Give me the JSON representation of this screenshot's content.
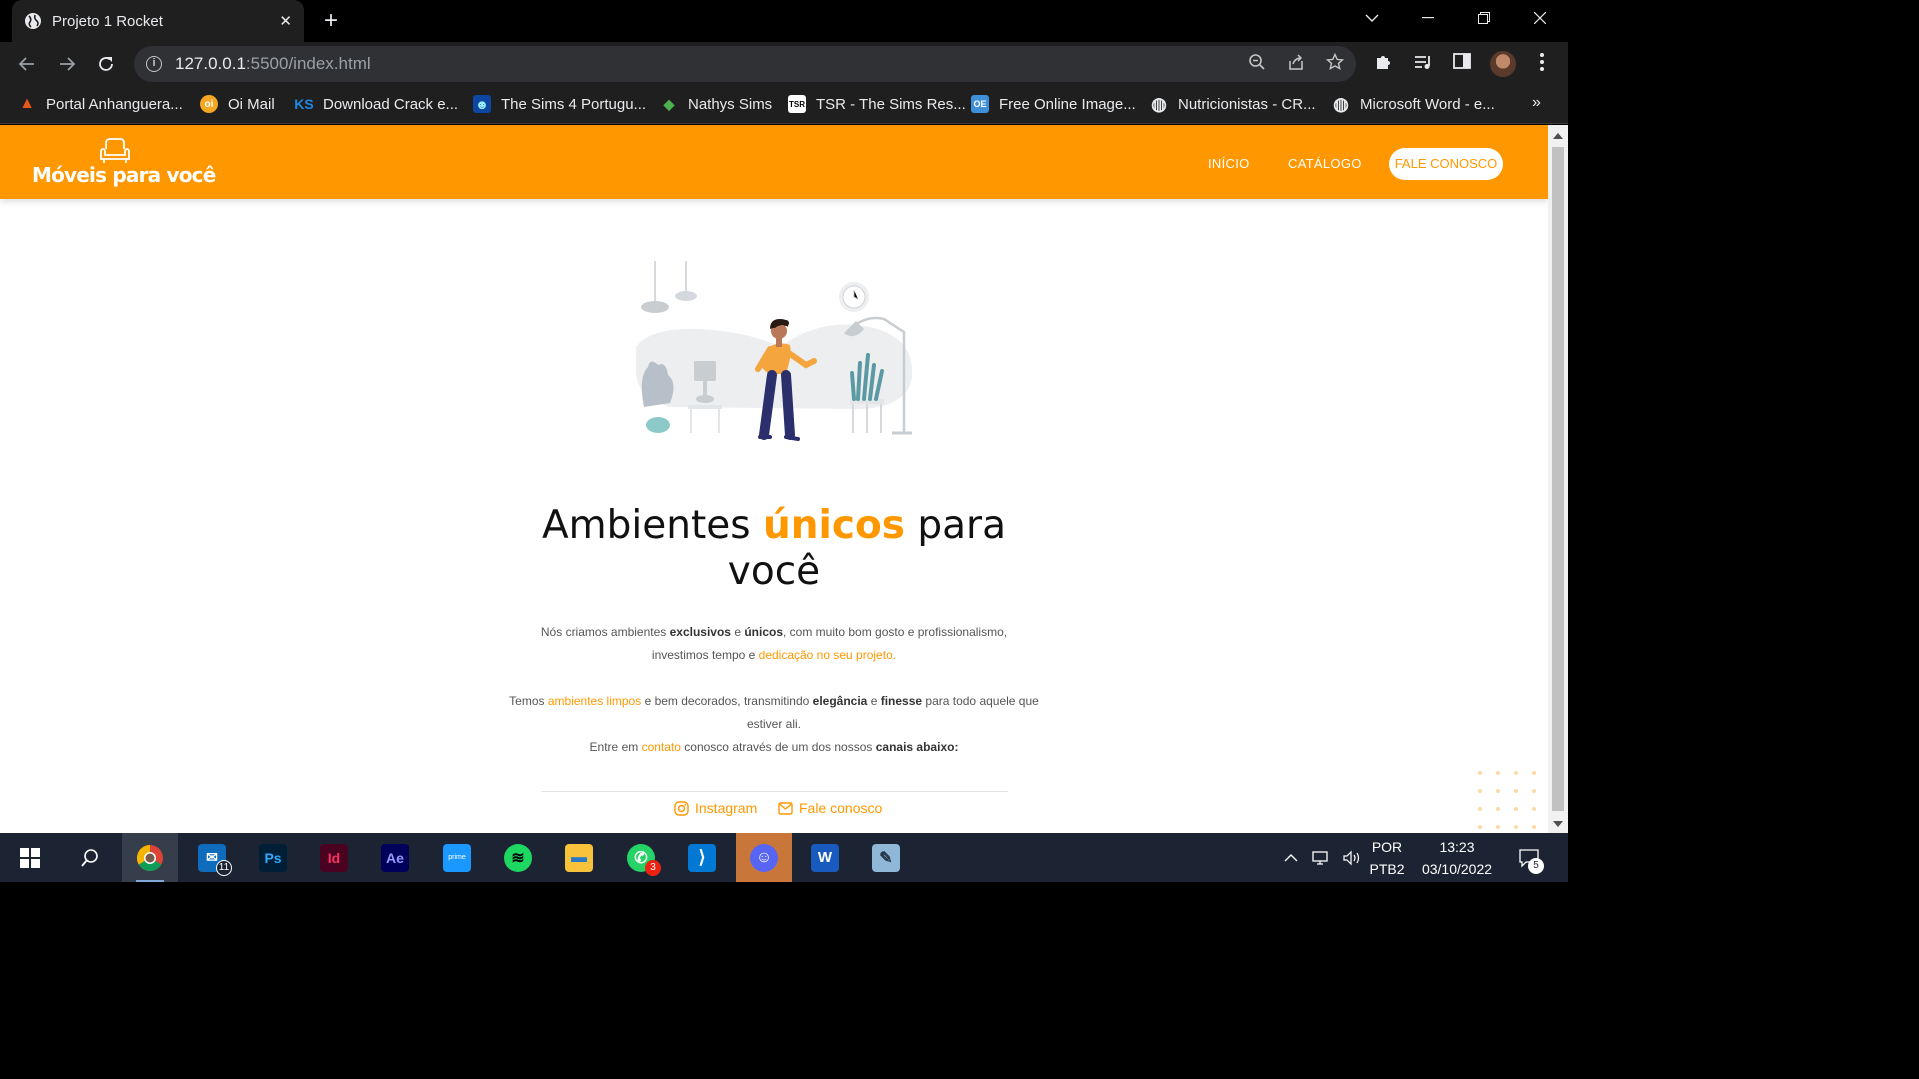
{
  "browser": {
    "tab_title": "Projeto 1 Rocket",
    "new_tab_label": "+",
    "url_host": "127.0.0.1",
    "url_path": ":5500/index.html",
    "bookmarks": [
      {
        "label": "Portal Anhanguera...",
        "color": "#e8571e",
        "glyph": "▲"
      },
      {
        "label": "Oi Mail",
        "color": "#f5a623",
        "glyph": "oi"
      },
      {
        "label": "Download Crack e...",
        "color": "#1e88e5",
        "glyph": "KS"
      },
      {
        "label": "The Sims 4 Portugu...",
        "color": "#0d47a1",
        "glyph": "☻"
      },
      {
        "label": "Nathys Sims",
        "color": "#4caf50",
        "glyph": "◆"
      },
      {
        "label": "TSR - The Sims Res...",
        "color": "#ffffff",
        "glyph": "TSR"
      },
      {
        "label": "Free Online Image...",
        "color": "#3f8fd8",
        "glyph": "OE"
      },
      {
        "label": "Nutricionistas - CR...",
        "color": "#e8eaed",
        "glyph": "◍"
      },
      {
        "label": "Microsoft Word - e...",
        "color": "#e8eaed",
        "glyph": "◍"
      }
    ],
    "more_label": "»"
  },
  "site": {
    "logo_text": "Móveis para você",
    "nav": {
      "home": "INÍCIO",
      "catalog": "CATÁLOGO",
      "contact": "FALE CONOSCO"
    },
    "accent_color": "#ff9800",
    "hero": {
      "title_before": "Ambientes ",
      "title_accent": "únicos",
      "title_after": " para você"
    },
    "p1": {
      "a": "Nós criamos ambientes ",
      "b": "exclusivos",
      "c": " e ",
      "d": "únicos",
      "e": ", com muito bom gosto e profissionalismo,",
      "f": "investimos tempo e ",
      "g": "dedicação no seu projeto."
    },
    "p2": {
      "a": "Temos ",
      "b": "ambientes limpos",
      "c": " e bem decorados, transmitindo ",
      "d": "elegância",
      "e": " e ",
      "f": "finesse",
      "g": " para todo aquele que estiver ali."
    },
    "p3": {
      "a": "Entre em ",
      "b": "contato",
      "c": " conosco através de um dos nossos ",
      "d": "canais abaixo:"
    },
    "social": {
      "instagram": "Instagram",
      "email": "Fale conosco"
    }
  },
  "taskbar": {
    "apps": [
      {
        "name": "chrome",
        "glyph": "",
        "bg": "#ffffff",
        "active": true
      },
      {
        "name": "mail",
        "glyph": "✉",
        "bg": "#0f6cbd",
        "badge": "11"
      },
      {
        "name": "photoshop",
        "glyph": "Ps",
        "bg": "#001e36",
        "color": "#31a8ff"
      },
      {
        "name": "indesign",
        "glyph": "Id",
        "bg": "#49021f",
        "color": "#ff3366"
      },
      {
        "name": "after-effects",
        "glyph": "Ae",
        "bg": "#00005b",
        "color": "#9999ff"
      },
      {
        "name": "prime-video",
        "glyph": "prime",
        "bg": "#1a98ff"
      },
      {
        "name": "spotify",
        "glyph": "≋",
        "bg": "#1ed760",
        "color": "#000"
      },
      {
        "name": "file-explorer",
        "glyph": "▬",
        "bg": "#f8c33a",
        "color": "#2b78c8"
      },
      {
        "name": "whatsapp",
        "glyph": "✆",
        "bg": "#25d366",
        "badge": "3"
      },
      {
        "name": "vscode",
        "glyph": "⟩",
        "bg": "#0078d4"
      },
      {
        "name": "discord",
        "glyph": "☺",
        "bg": "#5865f2",
        "active": true
      },
      {
        "name": "word",
        "glyph": "W",
        "bg": "#185abd"
      },
      {
        "name": "notepad",
        "glyph": "✎",
        "bg": "#8fb8d8"
      }
    ],
    "language_top": "POR",
    "language_bottom": "PTB2",
    "time": "13:23",
    "date": "03/10/2022",
    "notifications": "5"
  }
}
